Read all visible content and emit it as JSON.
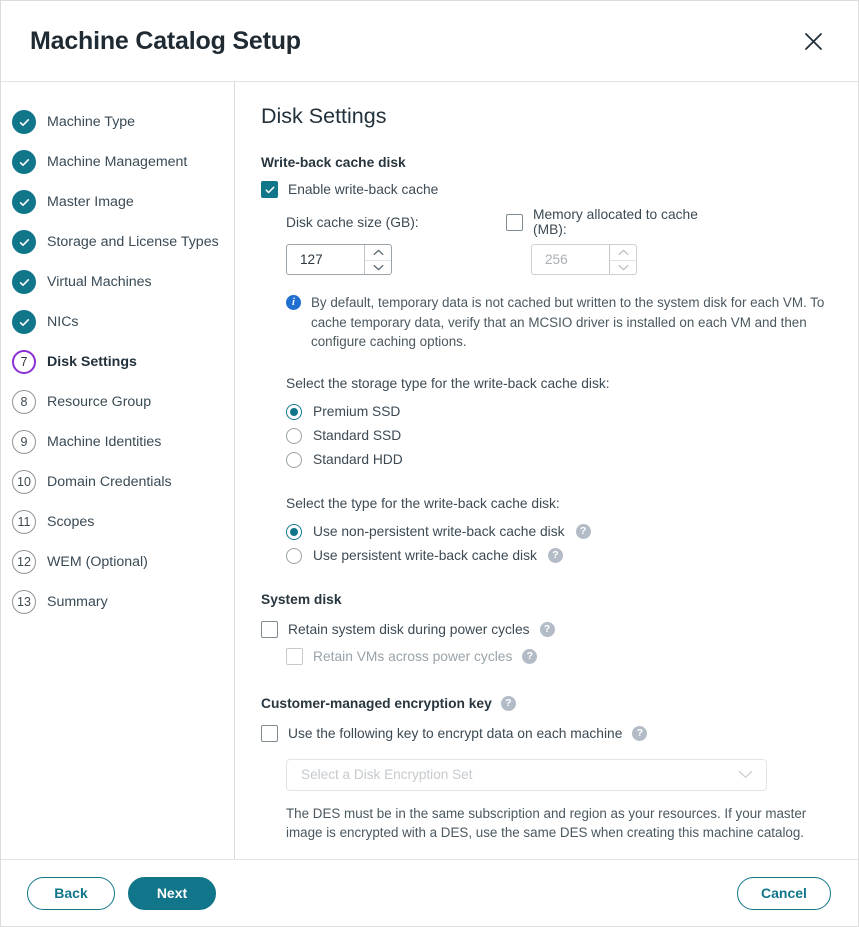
{
  "header": {
    "title": "Machine Catalog Setup",
    "close_icon": "close-icon"
  },
  "sidebar": {
    "steps": [
      {
        "marker": "check",
        "number": "1",
        "label": "Machine Type",
        "state": "done"
      },
      {
        "marker": "check",
        "number": "2",
        "label": "Machine Management",
        "state": "done"
      },
      {
        "marker": "check",
        "number": "3",
        "label": "Master Image",
        "state": "done"
      },
      {
        "marker": "check",
        "number": "4",
        "label": "Storage and License Types",
        "state": "done"
      },
      {
        "marker": "check",
        "number": "5",
        "label": "Virtual Machines",
        "state": "done"
      },
      {
        "marker": "check",
        "number": "6",
        "label": "NICs",
        "state": "done"
      },
      {
        "marker": "number",
        "number": "7",
        "label": "Disk Settings",
        "state": "current"
      },
      {
        "marker": "number",
        "number": "8",
        "label": "Resource Group",
        "state": "todo"
      },
      {
        "marker": "number",
        "number": "9",
        "label": "Machine Identities",
        "state": "todo"
      },
      {
        "marker": "number",
        "number": "10",
        "label": "Domain Credentials",
        "state": "todo"
      },
      {
        "marker": "number",
        "number": "11",
        "label": "Scopes",
        "state": "todo"
      },
      {
        "marker": "number",
        "number": "12",
        "label": "WEM (Optional)",
        "state": "todo"
      },
      {
        "marker": "number",
        "number": "13",
        "label": "Summary",
        "state": "todo"
      }
    ]
  },
  "main": {
    "page_title": "Disk Settings",
    "writeback": {
      "heading": "Write-back cache disk",
      "enable_label": "Enable write-back cache",
      "enable_checked": true,
      "disk_cache_label": "Disk cache size (GB):",
      "disk_cache_value": "127",
      "memory_label": "Memory allocated to cache (MB):",
      "memory_checked": false,
      "memory_value": "256",
      "memory_disabled": true,
      "note": "By default, temporary data is not cached but written to the system disk for each VM. To cache temporary data, verify that an MCSIO driver is installed on each VM and then configure caching options."
    },
    "storage_type": {
      "prompt": "Select the storage type for the write-back cache disk:",
      "options": [
        {
          "label": "Premium SSD",
          "selected": true
        },
        {
          "label": "Standard SSD",
          "selected": false
        },
        {
          "label": "Standard HDD",
          "selected": false
        }
      ]
    },
    "cache_type": {
      "prompt": "Select the type for the write-back cache disk:",
      "options": [
        {
          "label": "Use non-persistent write-back cache disk",
          "selected": true,
          "help": "?"
        },
        {
          "label": "Use persistent write-back cache disk",
          "selected": false,
          "help": "?"
        }
      ]
    },
    "system_disk": {
      "heading": "System disk",
      "retain_disk_label": "Retain system disk during power cycles",
      "retain_disk_checked": false,
      "retain_disk_help": "?",
      "retain_vms_label": "Retain VMs across power cycles",
      "retain_vms_checked": false,
      "retain_vms_disabled": true,
      "retain_vms_help": "?"
    },
    "encryption": {
      "heading": "Customer-managed encryption key",
      "heading_help": "?",
      "use_key_label": "Use the following key to encrypt data on each machine",
      "use_key_checked": false,
      "use_key_help": "?",
      "select_placeholder": "Select a Disk Encryption Set",
      "select_disabled": true,
      "helper_text": "The DES must be in the same subscription and region as your resources. If your master image is encrypted with a DES, use the same DES when creating this machine catalog."
    }
  },
  "footer": {
    "back_label": "Back",
    "next_label": "Next",
    "cancel_label": "Cancel"
  },
  "colors": {
    "accent_teal": "#11768a",
    "current_step_purple": "#8b2fd4",
    "info_blue": "#1f6fd0",
    "help_gray": "#b3bcc6"
  }
}
